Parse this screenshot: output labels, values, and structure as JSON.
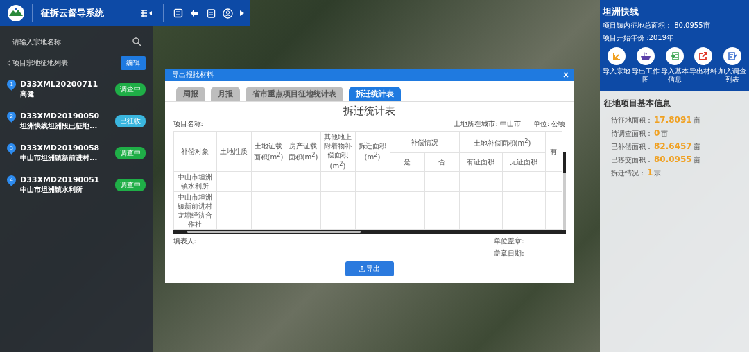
{
  "app": {
    "title": "征拆云督导系统"
  },
  "sidebar": {
    "search": {
      "placeholder": "请输入宗地名称"
    },
    "list_title": "项目宗地征地列表",
    "edit_button": "编辑",
    "items": [
      {
        "index": "1",
        "code": "D33XML20200711",
        "name": "高健",
        "status": "调查中",
        "color": "#1fae47"
      },
      {
        "index": "2",
        "code": "D33XMD20190050",
        "name": "坦洲快线坦洲段已征地...",
        "status": "已征收",
        "color": "#3ab6df"
      },
      {
        "index": "3",
        "code": "D33XMD20190058",
        "name": "中山市坦洲镇新前进村...",
        "status": "调查中",
        "color": "#1fae47"
      },
      {
        "index": "4",
        "code": "D33XMD20190051",
        "name": "中山市坦洲镇水利所",
        "status": "调查中",
        "color": "#1fae47"
      }
    ]
  },
  "project": {
    "title": "坦洲快线",
    "total_area": "项目镇内征地总面积： 80.0955亩",
    "start_year": "项目开始年份 :2019年",
    "actions": [
      {
        "label": "导入宗地",
        "kind": "import"
      },
      {
        "label": "导出工作图",
        "kind": "map"
      },
      {
        "label": "导入基本信息",
        "kind": "info"
      },
      {
        "label": "导出材料",
        "kind": "export"
      },
      {
        "label": "加入调查列表",
        "kind": "survey"
      }
    ]
  },
  "info": {
    "title": "征地项目基本信息",
    "rows": [
      {
        "label": "待征地面积：",
        "value": "17.8091",
        "unit": "亩"
      },
      {
        "label": "待调查面积：",
        "value": "0",
        "unit": "亩"
      },
      {
        "label": "已补偿面积：",
        "value": "82.6457",
        "unit": "亩"
      },
      {
        "label": "已移交面积：",
        "value": "80.0955",
        "unit": "亩"
      },
      {
        "label": "拆迁情况：",
        "value": "1",
        "unit": "宗"
      }
    ]
  },
  "dialog": {
    "title": "导出报批材料",
    "tabs": [
      {
        "label": "周报",
        "selected": false
      },
      {
        "label": "月报",
        "selected": false
      },
      {
        "label": "省市重点项目征地统计表",
        "selected": false
      },
      {
        "label": "拆迁统计表",
        "selected": true
      }
    ],
    "heading": "拆迁统计表",
    "project_label": "项目名称:",
    "city": "土地所在城市: 中山市",
    "unit": "单位: 公顷",
    "columns": [
      "补偿对象",
      "土地性质",
      "土地证载面积(m$^{2}$)",
      "房产证载面积(m$^{2}$)",
      "其他地上附着物补偿面积(m$^{2}$)",
      "拆迁面积(m$^{2}$)"
    ],
    "group_columns": [
      {
        "label": "补偿情况",
        "sub": [
          "是",
          "否"
        ]
      },
      {
        "label": "土地补偿面积(m$^{2}$)",
        "sub": [
          "有证面积",
          "无证面积"
        ]
      }
    ],
    "cut_column": "有",
    "rows": [
      "中山市坦洲镇水利所",
      "中山市坦洲镇新前进村龙塘经济合作社"
    ],
    "filler": "填表人:",
    "seal": "单位盖章:",
    "seal_date": "盖章日期:",
    "export_button": "导出"
  }
}
